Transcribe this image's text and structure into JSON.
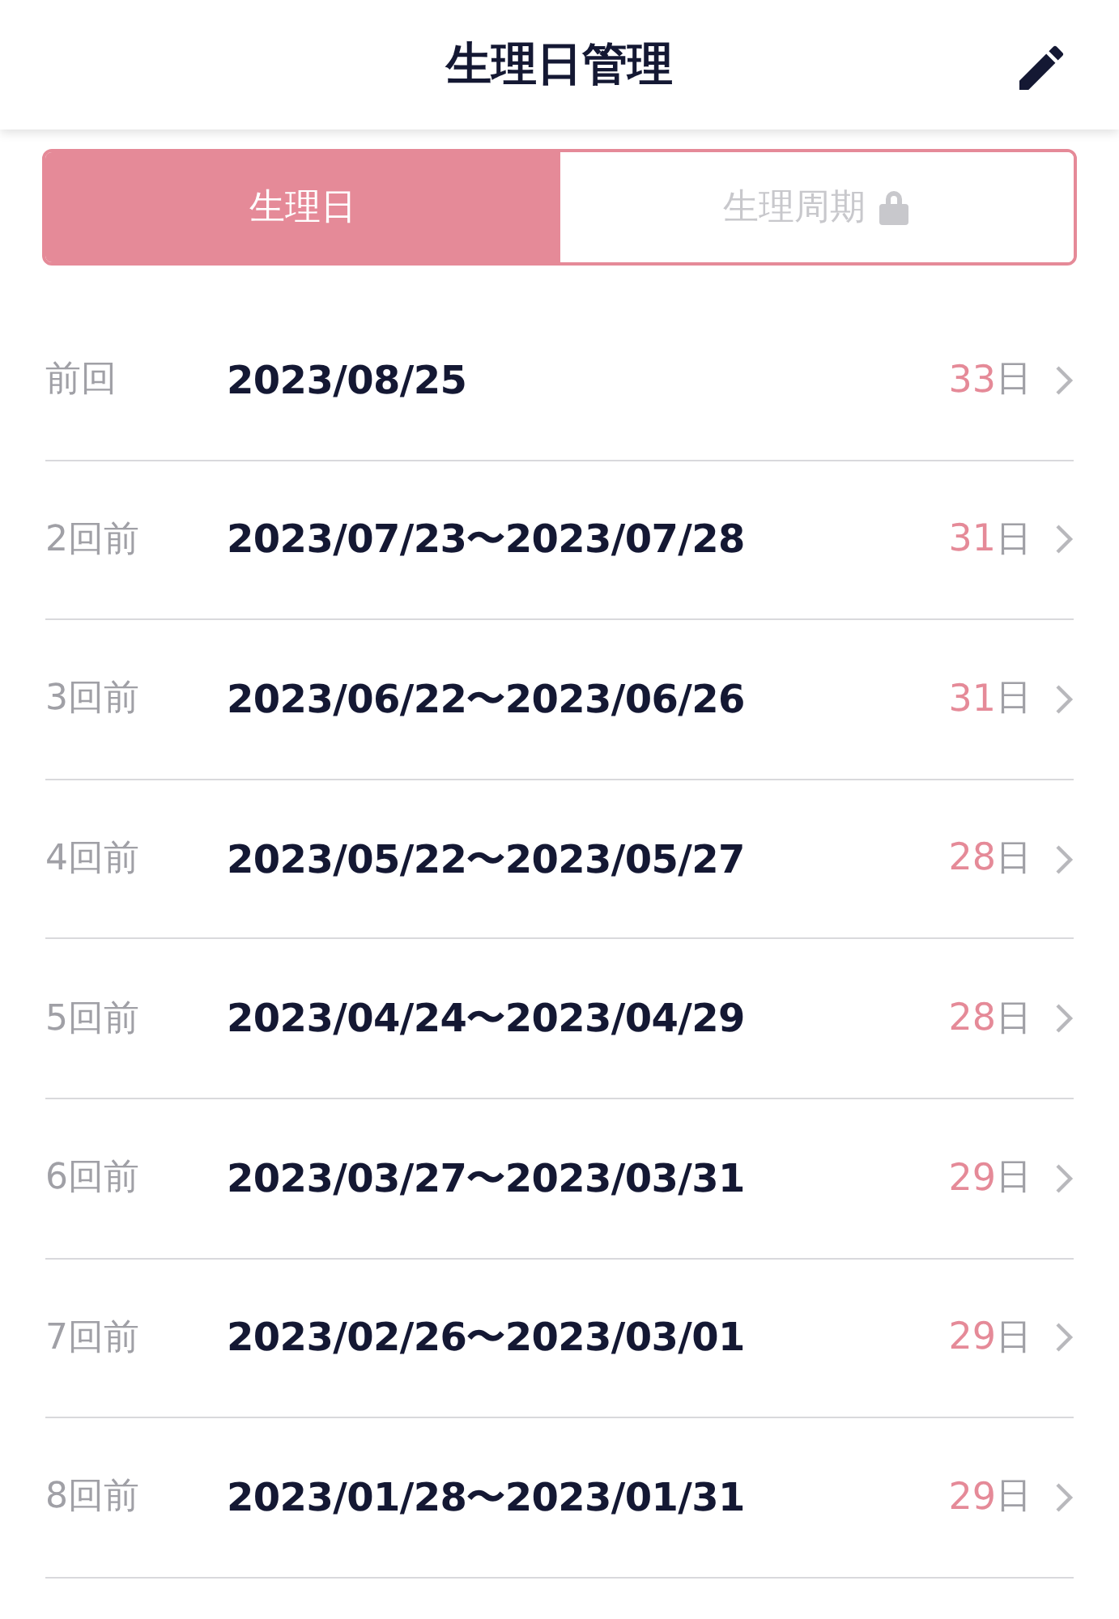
{
  "header": {
    "title": "生理日管理"
  },
  "tabs": [
    {
      "label": "生理日",
      "selected": true,
      "locked": false
    },
    {
      "label": "生理周期",
      "selected": false,
      "locked": true
    }
  ],
  "records": [
    {
      "label": "前回",
      "dates": "2023/08/25",
      "days": "33",
      "unit": "日"
    },
    {
      "label": "2回前",
      "dates": "2023/07/23〜2023/07/28",
      "days": "31",
      "unit": "日"
    },
    {
      "label": "3回前",
      "dates": "2023/06/22〜2023/06/26",
      "days": "31",
      "unit": "日"
    },
    {
      "label": "4回前",
      "dates": "2023/05/22〜2023/05/27",
      "days": "28",
      "unit": "日"
    },
    {
      "label": "5回前",
      "dates": "2023/04/24〜2023/04/29",
      "days": "28",
      "unit": "日"
    },
    {
      "label": "6回前",
      "dates": "2023/03/27〜2023/03/31",
      "days": "29",
      "unit": "日"
    },
    {
      "label": "7回前",
      "dates": "2023/02/26〜2023/03/01",
      "days": "29",
      "unit": "日"
    },
    {
      "label": "8回前",
      "dates": "2023/01/28〜2023/01/31",
      "days": "29",
      "unit": "日"
    }
  ]
}
